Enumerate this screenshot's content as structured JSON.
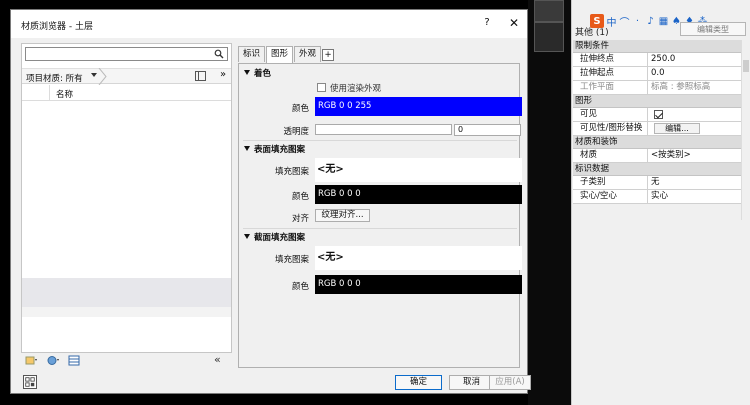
{
  "dialog": {
    "title": "材质浏览器 - 土层",
    "help_label": "?",
    "close_label": "✕"
  },
  "left": {
    "search_placeholder": "",
    "library_label": "项目材质: 所有",
    "double_arrow": "»",
    "name_header": "名称",
    "collapse_label": "«"
  },
  "tabs": [
    {
      "label": "标识"
    },
    {
      "label": "图形"
    },
    {
      "label": "外观"
    },
    {
      "label": "+"
    }
  ],
  "shading": {
    "header": "着色",
    "use_render_label": "使用渲染外观",
    "color_label": "颜色",
    "color_value": "RGB 0 0 255",
    "color_hex": "#0000ff",
    "transparency_label": "透明度",
    "transparency_value": "0"
  },
  "surface": {
    "header": "表面填充图案",
    "pattern_label": "填充图案",
    "pattern_value": "<无>",
    "color_label": "颜色",
    "color_value": "RGB 0 0 0",
    "color_hex": "#000000",
    "align_label": "对齐",
    "align_button": "纹理对齐..."
  },
  "cut": {
    "header": "截面填充图案",
    "pattern_label": "填充图案",
    "pattern_value": "<无>",
    "color_label": "颜色",
    "color_value": "RGB 0 0 0",
    "color_hex": "#000000"
  },
  "buttons": {
    "ok": "确定",
    "cancel": "取消",
    "apply": "应用(A)"
  },
  "properties": {
    "type_label": "其他 (1)",
    "edit_type": "编辑类型",
    "ime_label": "S",
    "ime_glyphs": [
      "中",
      "⌒",
      "·",
      "♪",
      "▦",
      "♠",
      "♦",
      "⁂"
    ],
    "sections": [
      {
        "header": "限制条件",
        "rows": [
          {
            "k": "拉伸终点",
            "v": "250.0",
            "dim": false
          },
          {
            "k": "拉伸起点",
            "v": "0.0",
            "dim": false
          },
          {
            "k": "工作平面",
            "v": "标高 : 参照标高",
            "dim": true
          }
        ]
      },
      {
        "header": "图形",
        "rows": [
          {
            "k": "可见",
            "v": "",
            "check": true
          },
          {
            "k": "可见性/图形替换",
            "v": "编辑...",
            "button": true
          }
        ]
      },
      {
        "header": "材质和装饰",
        "rows": [
          {
            "k": "材质",
            "v": "<按类别>"
          }
        ]
      },
      {
        "header": "标识数据",
        "rows": [
          {
            "k": "子类别",
            "v": "无"
          },
          {
            "k": "实心/空心",
            "v": "实心"
          }
        ]
      }
    ]
  }
}
